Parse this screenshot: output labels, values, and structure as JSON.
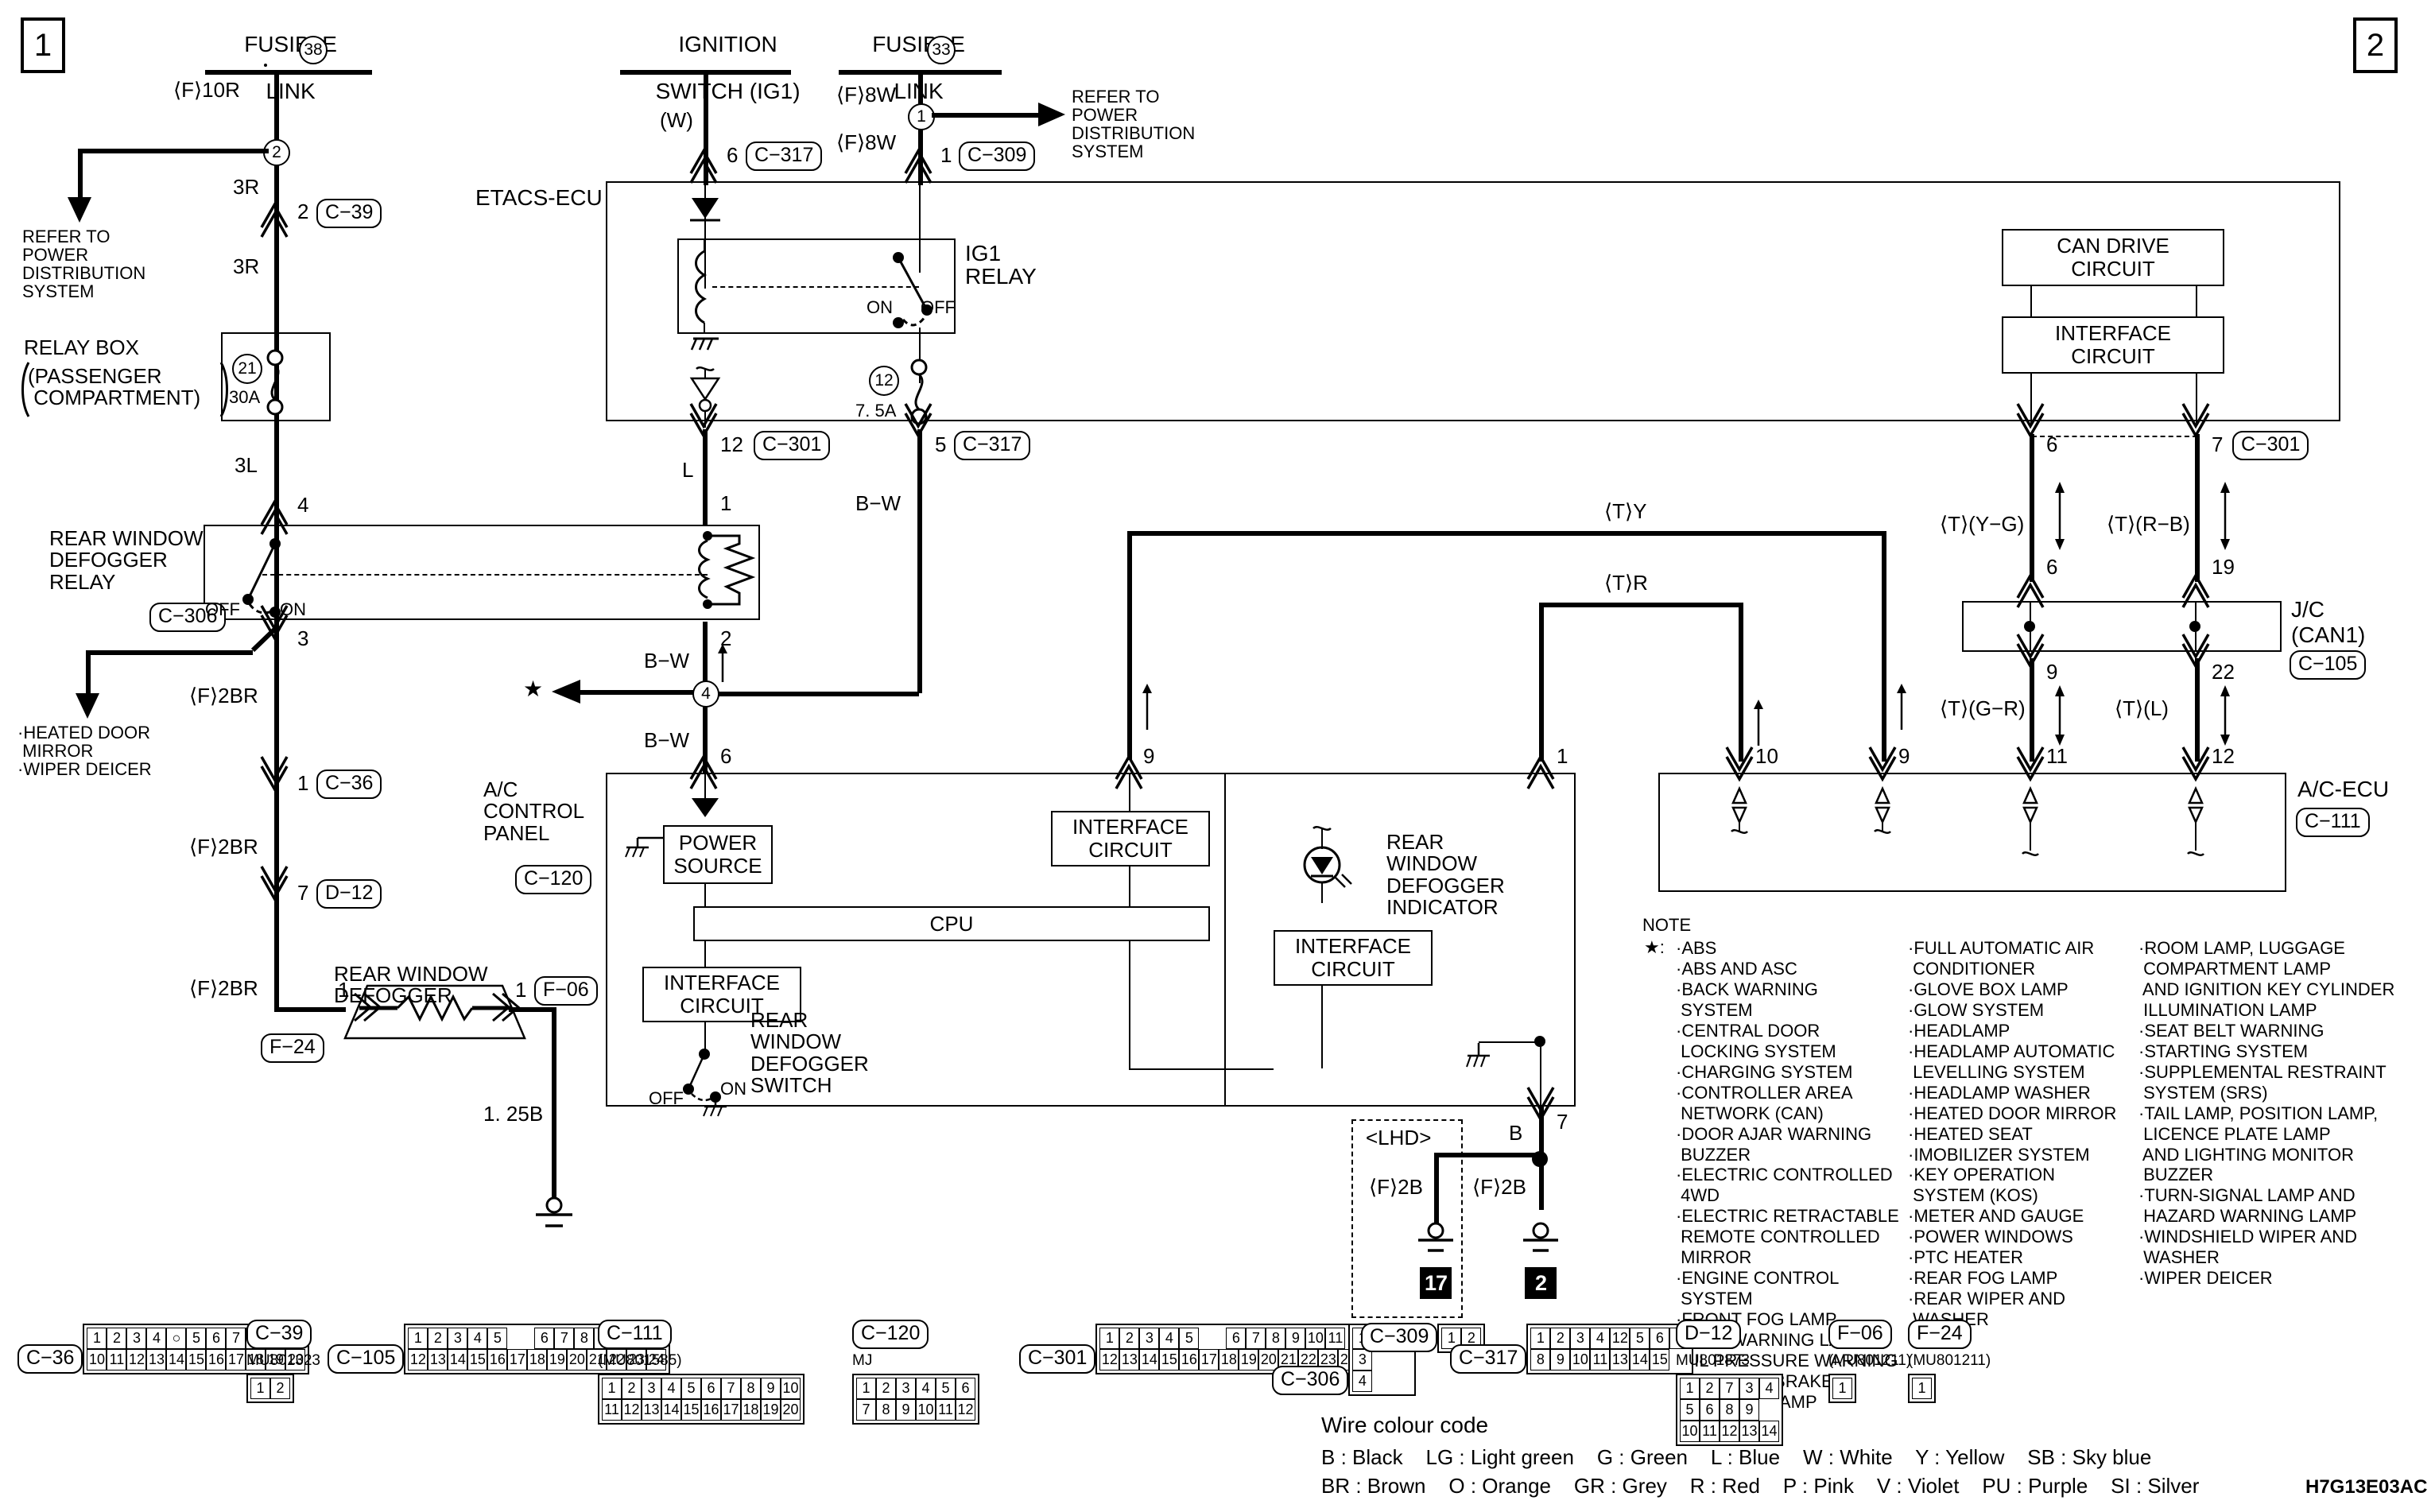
{
  "page": {
    "left_page_number": "1",
    "right_page_number": "2",
    "doc_code": "H7G13E03AC"
  },
  "sources": {
    "fusible_link_38": {
      "label1": "FUSIBLE",
      "label2": "LINK",
      "num": "38"
    },
    "ignition_switch": {
      "label1": "IGNITION",
      "label2": "SWITCH (IG1)"
    },
    "fusible_link_33": {
      "label1": "FUSIBLE",
      "label2": "LINK",
      "num": "33"
    }
  },
  "refs": {
    "left_refer": "REFER TO\nPOWER\nDISTRIBUTION\nSYSTEM",
    "right_refer": "REFER TO\nPOWER\nDISTRIBUTION\nSYSTEM",
    "heated_items": "·HEATED DOOR\n MIRROR\n·WIPER DEICER"
  },
  "wires": {
    "f10r": "⟨F⟩10R",
    "three_r_top": "3R",
    "three_r_bot": "3R",
    "three_l": "3L",
    "f8w_top": "⟨F⟩8W",
    "f8w_bot": "⟨F⟩8W",
    "w_paren": "(W)",
    "l": "L",
    "bw_1": "B−W",
    "bw_2": "B−W",
    "bw_3": "B−W",
    "f2br_1": "⟨F⟩2BR",
    "f2br_2": "⟨F⟩2BR",
    "f2br_3": "⟨F⟩2BR",
    "size_125b": "1. 25B",
    "b": "B",
    "f2b_left": "⟨F⟩2B",
    "f2b_right": "⟨F⟩2B",
    "t_y": "⟨T⟩Y",
    "t_r": "⟨T⟩R",
    "t_yg": "⟨T⟩(Y−G)",
    "t_rb": "⟨T⟩(R−B)",
    "t_gr": "⟨T⟩(G−R)",
    "t_l": "⟨T⟩(L)"
  },
  "nodes": {
    "n2": "2",
    "n1": "1",
    "n4": "4",
    "n12": "12",
    "n21": "21"
  },
  "relay_box": {
    "title": "RELAY BOX",
    "sub1": "PASSENGER",
    "sub2": "COMPARTMENT",
    "fuse_num": "21",
    "fuse_rating": "30A"
  },
  "etacs": {
    "title": "ETACS-ECU",
    "ig1_relay": "IG1\nRELAY",
    "relay_on": "ON",
    "relay_off": "OFF",
    "fuse_num": "12",
    "fuse_rating": "7. 5A"
  },
  "defogger_relay": {
    "title": "REAR WINDOW\nDEFOGGER\nRELAY",
    "connector": "C−306",
    "off": "OFF",
    "on": "ON",
    "pin_top": "4",
    "pin_bot": "3",
    "pin_coil_top": "1",
    "pin_coil_bot": "2"
  },
  "defogger": {
    "title": "REAR WINDOW\nDEFOGGER",
    "pin_left": "1",
    "pin_right": "1",
    "conn_left": "F−24",
    "conn_right": "F−06"
  },
  "ac_panel": {
    "title": "A/C\nCONTROL\nPANEL",
    "connector": "C−120",
    "power_source": "POWER\nSOURCE",
    "cpu": "CPU",
    "interface_1": "INTERFACE\nCIRCUIT",
    "interface_2": "INTERFACE\nCIRCUIT",
    "interface_3": "INTERFACE\nCIRCUIT",
    "switch_label": "REAR\nWINDOW\nDEFOGGER\nSWITCH",
    "switch_off": "OFF",
    "switch_on": "ON",
    "indicator_label": "REAR\nWINDOW\nDEFOGGER\nINDICATOR",
    "pin_power": "6",
    "pin_iface": "9",
    "pin_ind": "1",
    "pin_gnd": "7"
  },
  "ac_ecu": {
    "title": "A/C-ECU",
    "connector": "C−111",
    "can_drive": "CAN DRIVE\nCIRCUIT",
    "interface": "INTERFACE\nCIRCUIT",
    "pins": [
      "10",
      "9",
      "11",
      "12"
    ]
  },
  "jc": {
    "title": "J/C",
    "sub": "(CAN1)",
    "connector": "C−105",
    "pin_in_left": "6",
    "pin_in_right": "19",
    "pin_out_left": "9",
    "pin_out_right": "22"
  },
  "connector_tags": {
    "c39": "C−39",
    "c36": "C−36",
    "d12": "D−12",
    "c317_top": "C−317",
    "c309": "C−309",
    "c301_mid": "C−301",
    "c317_mid": "C−317",
    "c301_right": "C−301",
    "c105": "C−105",
    "c111": "C−111",
    "c120": "C−120",
    "c306": "C−306",
    "f24": "F−24",
    "f06": "F−06"
  },
  "pin_numbers": {
    "p2_c39": "2",
    "p6_c317": "6",
    "p1_c309": "1",
    "p12_c301": "12",
    "p5_c317": "5",
    "p1_c36": "1",
    "p7_d12": "7",
    "p6_c301r": "6",
    "p7_c301r": "7",
    "p6_jc": "6",
    "p19_jc": "19",
    "p9_jc": "9",
    "p22_jc": "22",
    "p11": "11",
    "p12": "12",
    "p10": "10",
    "p9": "9",
    "p1_ind": "1",
    "p9_iface": "9",
    "p7_gnd": "7"
  },
  "lhd": {
    "label": "<LHD>",
    "ground_left": "17",
    "ground_right": "2"
  },
  "note": {
    "heading": "NOTE",
    "marker": "★:",
    "col1": [
      "·ABS",
      "·ABS AND ASC",
      "·BACK WARNING",
      " SYSTEM",
      "·CENTRAL DOOR",
      " LOCKING SYSTEM",
      "·CHARGING SYSTEM",
      "·CONTROLLER AREA",
      " NETWORK (CAN)",
      "·DOOR AJAR WARNING",
      " BUZZER",
      "·ELECTRIC CONTROLLED",
      " 4WD",
      "·ELECTRIC RETRACTABLE",
      " REMOTE CONTROLLED",
      " MIRROR",
      "·ENGINE CONTROL",
      " SYSTEM",
      "·FRONT FOG LAMP",
      "·FUEL WARNING LAMP,",
      " OIL PRESSURE WARNING",
      " LAMP AND BRAKE",
      " WARNING LAMP"
    ],
    "col2": [
      "·FULL AUTOMATIC AIR",
      " CONDITIONER",
      "·GLOVE BOX LAMP",
      "·GLOW SYSTEM",
      "·HEADLAMP",
      "·HEADLAMP AUTOMATIC",
      " LEVELLING SYSTEM",
      "·HEADLAMP WASHER",
      "·HEATED DOOR MIRROR",
      "·HEATED SEAT",
      "·IMOBILIZER SYSTEM",
      "·KEY OPERATION",
      " SYSTEM (KOS)",
      "·METER AND GAUGE",
      "·POWER WINDOWS",
      "·PTC HEATER",
      "·REAR FOG LAMP",
      "·REAR WIPER AND",
      " WASHER"
    ],
    "col3": [
      "·ROOM LAMP, LUGGAGE",
      " COMPARTMENT LAMP",
      " AND IGNITION KEY CYLINDER",
      " ILLUMINATION LAMP",
      "·SEAT BELT WARNING",
      "·STARTING SYSTEM",
      "·SUPPLEMENTAL RESTRAINT",
      " SYSTEM (SRS)",
      "·TAIL LAMP, POSITION LAMP,",
      " LICENCE PLATE LAMP",
      " AND LIGHTING MONITOR",
      " BUZZER",
      "·TURN-SIGNAL LAMP AND",
      " HAZARD WARNING LAMP",
      "·WINDSHIELD WIPER AND",
      " WASHER",
      "·WIPER DEICER"
    ]
  },
  "connectors": [
    {
      "id": "C−36",
      "part": "",
      "rows": [
        [
          "1",
          "2",
          "3",
          "4",
          "○",
          "5",
          "6",
          "7",
          "8",
          "9"
        ],
        [
          "10",
          "11",
          "12",
          "13",
          "14",
          "15",
          "16",
          "17",
          "18",
          "19",
          "20"
        ]
      ]
    },
    {
      "id": "C−39",
      "part": "MU801323",
      "rows": [
        [
          "1",
          "2"
        ]
      ]
    },
    {
      "id": "C−105",
      "part": "",
      "rows": [
        [
          "1",
          "2",
          "3",
          "4",
          "5",
          "",
          "6",
          "7",
          "8",
          "9",
          "10",
          "11"
        ],
        [
          "12",
          "13",
          "14",
          "15",
          "16",
          "17",
          "18",
          "19",
          "20",
          "21",
          "22",
          "23",
          "24"
        ]
      ]
    },
    {
      "id": "C−111",
      "part": "(MU801585)",
      "rows": [
        [
          "1",
          "2",
          "3",
          "4",
          "5",
          "6",
          "7",
          "8",
          "9",
          "10"
        ],
        [
          "11",
          "12",
          "13",
          "14",
          "15",
          "16",
          "17",
          "18",
          "19",
          "20"
        ]
      ]
    },
    {
      "id": "C−120",
      "part": "MJ",
      "rows": [
        [
          "1",
          "2",
          "3",
          "4",
          "5",
          "6"
        ],
        [
          "7",
          "8",
          "9",
          "10",
          "11",
          "12"
        ]
      ]
    },
    {
      "id": "C−301",
      "part": "",
      "rows": [
        [
          "1",
          "2",
          "3",
          "4",
          "5",
          "",
          "6",
          "7",
          "8",
          "9",
          "10",
          "11"
        ],
        [
          "12",
          "13",
          "14",
          "15",
          "16",
          "17",
          "18",
          "19",
          "20",
          "21",
          "22",
          "23",
          "24"
        ]
      ]
    },
    {
      "id": "C−306",
      "part": "",
      "rows": [
        [
          "1",
          "⊠",
          "2"
        ],
        [
          "3"
        ],
        [
          "4"
        ]
      ]
    },
    {
      "id": "C−309",
      "part": "",
      "rows": [
        [
          "1",
          "2"
        ]
      ]
    },
    {
      "id": "C−317",
      "part": "",
      "rows": [
        [
          "1",
          "2",
          "3",
          "4",
          "12",
          "5",
          "6",
          "7"
        ],
        [
          "8",
          "9",
          "10",
          "11",
          "13",
          "14",
          "15"
        ]
      ]
    },
    {
      "id": "D−12",
      "part": "MU801873",
      "rows": [
        [
          "1",
          "2",
          "7",
          "3",
          "4"
        ],
        [
          "5",
          "6",
          "8",
          "9"
        ],
        [
          "10",
          "11",
          "12",
          "13",
          "14"
        ]
      ]
    },
    {
      "id": "F−06",
      "part": "(MU801211)",
      "rows": [
        [
          "1"
        ]
      ]
    },
    {
      "id": "F−24",
      "part": "(MU801211)",
      "rows": [
        [
          "1"
        ]
      ]
    }
  ],
  "wire_colour_code": {
    "title": "Wire colour code",
    "line1": "B : Black    LG : Light green    G : Green    L : Blue    W : White    Y : Yellow    SB : Sky blue",
    "line2": "BR : Brown    O : Orange    GR : Grey    R : Red    P : Pink    V : Violet    PU : Purple    SI : Silver",
    "entries": [
      {
        "code": "B",
        "name": "Black"
      },
      {
        "code": "LG",
        "name": "Light green"
      },
      {
        "code": "G",
        "name": "Green"
      },
      {
        "code": "L",
        "name": "Blue"
      },
      {
        "code": "W",
        "name": "White"
      },
      {
        "code": "Y",
        "name": "Yellow"
      },
      {
        "code": "SB",
        "name": "Sky blue"
      },
      {
        "code": "BR",
        "name": "Brown"
      },
      {
        "code": "O",
        "name": "Orange"
      },
      {
        "code": "GR",
        "name": "Grey"
      },
      {
        "code": "R",
        "name": "Red"
      },
      {
        "code": "P",
        "name": "Pink"
      },
      {
        "code": "V",
        "name": "Violet"
      },
      {
        "code": "PU",
        "name": "Purple"
      },
      {
        "code": "SI",
        "name": "Silver"
      }
    ]
  }
}
